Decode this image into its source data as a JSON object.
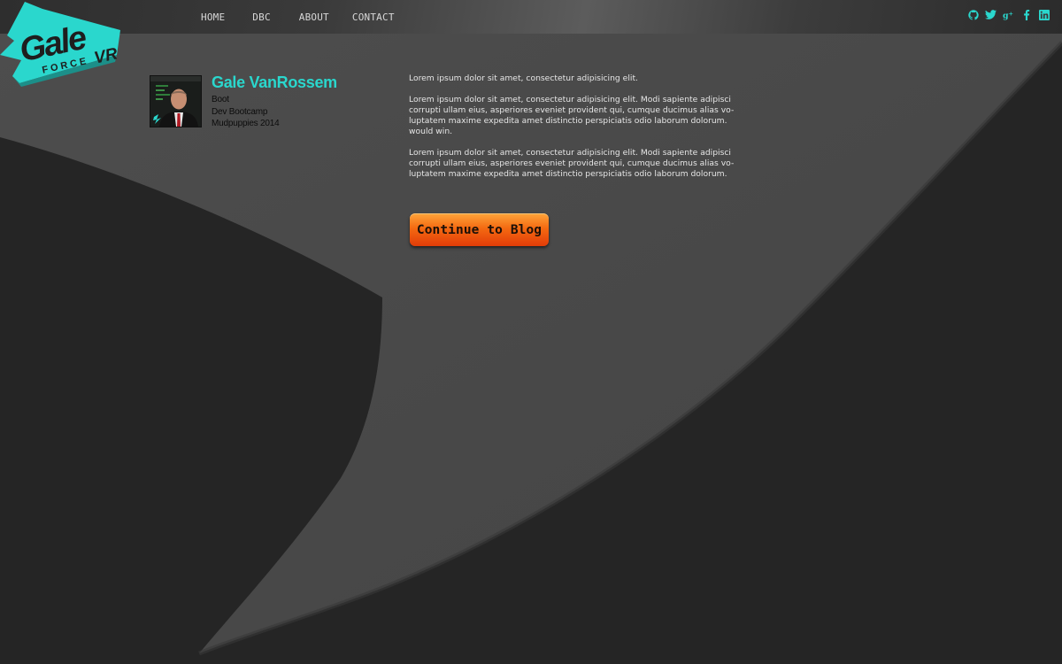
{
  "brand": {
    "logo_main": "Gale",
    "logo_sub": "FORCE",
    "logo_vr": "VR"
  },
  "nav": {
    "items": [
      "HOME",
      "DBC",
      "ABOUT",
      "CONTACT"
    ]
  },
  "social": {
    "icons": [
      "github-icon",
      "twitter-icon",
      "google-plus-icon",
      "facebook-icon",
      "linkedin-icon"
    ],
    "color": "#2ad7cd"
  },
  "profile": {
    "name": "Gale VanRossem",
    "lines": [
      "Boot",
      "Dev Bootcamp",
      "Mudpuppies 2014"
    ]
  },
  "content": {
    "paragraphs": [
      "Lorem ipsum dolor sit amet, consectetur adipisicing elit.",
      "Lorem ipsum dolor sit amet, consectetur adipisicing elit. Modi sapiente adipisci corrupti ullam eius, asperiores eveniet provident qui, cumque ducimus alias vo-luptatem maxime expedita amet distinctio perspiciatis odio laborum dolorum. would win.",
      "Lorem ipsum dolor sit amet, consectetur adipisicing elit. Modi sapiente adipisci corrupti ullam eius, asperiores eveniet provident qui, cumque ducimus alias vo-luptatem maxime expedita amet distinctio perspiciatis odio laborum dolorum."
    ]
  },
  "cta": {
    "label": "Continue to Blog"
  },
  "colors": {
    "accent": "#2ad7cd",
    "background": "#252525",
    "swoosh": "#4a4a4a",
    "button_top": "#ffa53a",
    "button_bottom": "#e23c08"
  }
}
